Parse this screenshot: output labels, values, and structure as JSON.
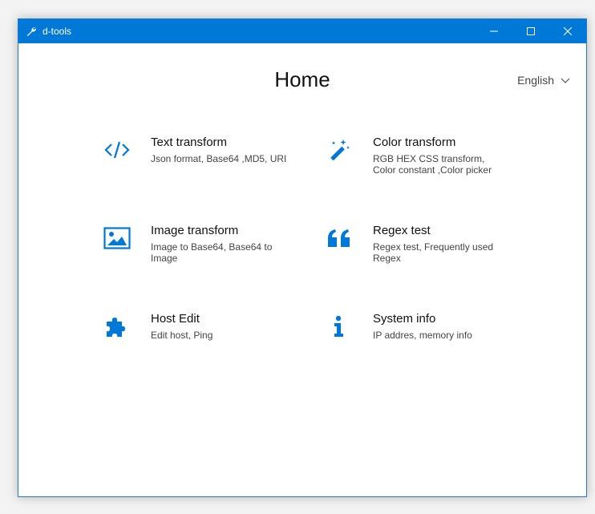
{
  "window": {
    "title": "d-tools"
  },
  "header": {
    "title": "Home",
    "language": "English"
  },
  "tools": [
    {
      "title": "Text transform",
      "description": "Json format, Base64 ,MD5, URI",
      "icon": "code-icon"
    },
    {
      "title": "Color transform",
      "description": "RGB HEX CSS transform, Color constant ,Color picker",
      "icon": "magic-wand-icon"
    },
    {
      "title": "Image transform",
      "description": "Image to Base64, Base64 to Image",
      "icon": "image-icon"
    },
    {
      "title": "Regex test",
      "description": "Regex test, Frequently used Regex",
      "icon": "quote-icon"
    },
    {
      "title": "Host Edit",
      "description": "Edit host, Ping",
      "icon": "puzzle-icon"
    },
    {
      "title": "System info",
      "description": "IP addres, memory info",
      "icon": "info-icon"
    }
  ],
  "colors": {
    "accent": "#0078d7",
    "titlebar": "#0078d7",
    "text": "#111111"
  }
}
